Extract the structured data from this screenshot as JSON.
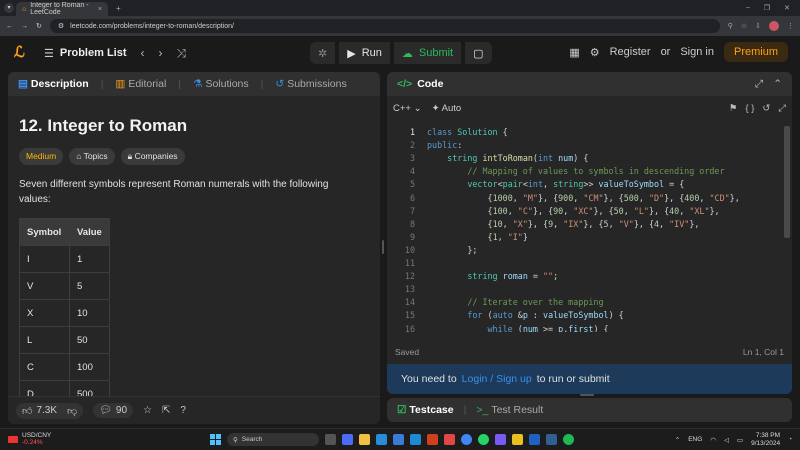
{
  "browser": {
    "tab_title": "Integer to Roman - LeetCode",
    "url": "leetcode.com/problems/integer-to-roman/description/",
    "new_tab": "+",
    "close": "×"
  },
  "nav": {
    "problem_list": "Problem List",
    "run": "Run",
    "submit": "Submit",
    "register": "Register",
    "or": "or",
    "sign_in": "Sign in",
    "premium": "Premium"
  },
  "left": {
    "tabs": [
      "Description",
      "Editorial",
      "Solutions",
      "Submissions"
    ],
    "title": "12. Integer to Roman",
    "tags": [
      "Medium",
      "Topics",
      "Companies"
    ],
    "description": "Seven different symbols represent Roman numerals with the following values:",
    "table": {
      "headers": [
        "Symbol",
        "Value"
      ],
      "rows": [
        [
          "I",
          "1"
        ],
        [
          "V",
          "5"
        ],
        [
          "X",
          "10"
        ],
        [
          "L",
          "50"
        ],
        [
          "C",
          "100"
        ],
        [
          "D",
          "500"
        ]
      ]
    },
    "footer": {
      "likes": "7.3K",
      "comments": "90"
    }
  },
  "right": {
    "header": "Code",
    "language": "C++",
    "auto": "Auto",
    "status_left": "Saved",
    "status_right": "Ln 1, Col 1",
    "login_pre": "You need to",
    "login_link": "Login / Sign up",
    "login_post": "to run or submit",
    "testcase": "Testcase",
    "test_result": "Test Result",
    "line_numbers": [
      "1",
      "2",
      "3",
      "4",
      "5",
      "6",
      "7",
      "8",
      "9",
      "10",
      "11",
      "12",
      "13",
      "14",
      "15",
      "16"
    ]
  },
  "taskbar": {
    "ticker": "USD/CNY",
    "ticker_change": "-0.24%",
    "search": "Search",
    "lang": "ENG",
    "time": "7:38 PM",
    "date": "9/13/2024"
  },
  "colors": {
    "accent": "#ffa116",
    "green": "#2cbb5d",
    "blue": "#3b8eea",
    "medium": "#ffb800"
  }
}
